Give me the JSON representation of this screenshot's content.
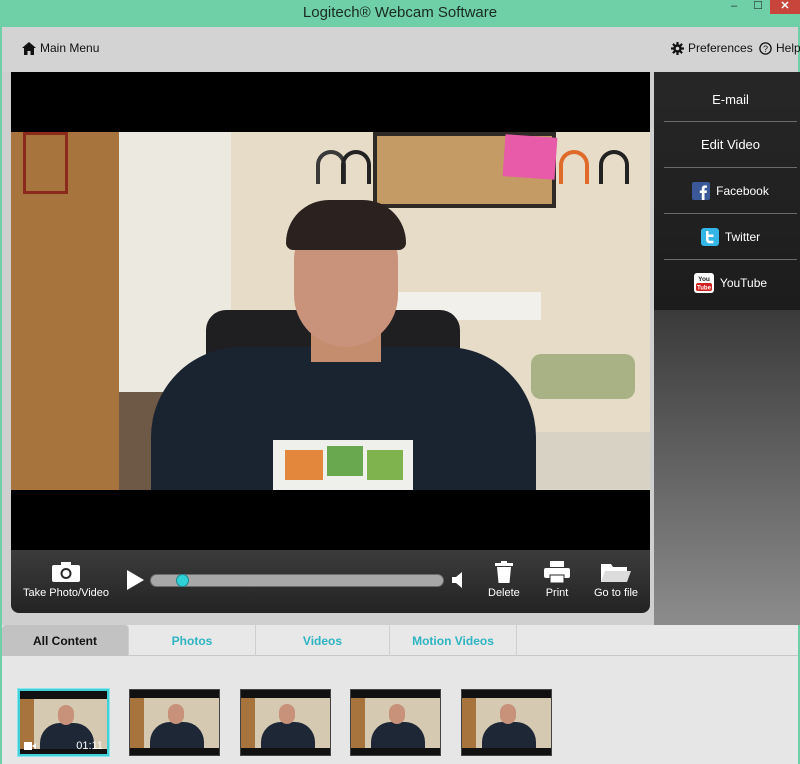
{
  "window": {
    "title": "Logitech® Webcam Software",
    "controls": {
      "minimize": "–",
      "maximize": "☐",
      "close": "✕"
    }
  },
  "topbar": {
    "main_menu": "Main Menu",
    "preferences": "Preferences",
    "help": "Help"
  },
  "player": {
    "take_photo_video": "Take Photo/Video",
    "delete": "Delete",
    "print": "Print",
    "go_to_file": "Go to file",
    "progress_fraction": 0.05,
    "accent_color": "#2fd0d6"
  },
  "share_panel": {
    "items": [
      {
        "label": "E-mail",
        "icon": ""
      },
      {
        "label": "Edit Video",
        "icon": ""
      },
      {
        "label": "Facebook",
        "icon": "facebook-icon"
      },
      {
        "label": "Twitter",
        "icon": "twitter-icon"
      },
      {
        "label": "YouTube",
        "icon": "youtube-icon"
      }
    ]
  },
  "tabs": [
    {
      "label": "All Content",
      "active": true
    },
    {
      "label": "Photos",
      "active": false
    },
    {
      "label": "Videos",
      "active": false
    },
    {
      "label": "Motion Videos",
      "active": false
    }
  ],
  "gallery": {
    "items": [
      {
        "duration": "01:11",
        "selected": true,
        "video": true
      },
      {
        "duration": "",
        "selected": false,
        "video": false
      },
      {
        "duration": "",
        "selected": false,
        "video": false
      },
      {
        "duration": "",
        "selected": false,
        "video": false
      },
      {
        "duration": "",
        "selected": false,
        "video": false
      }
    ]
  }
}
